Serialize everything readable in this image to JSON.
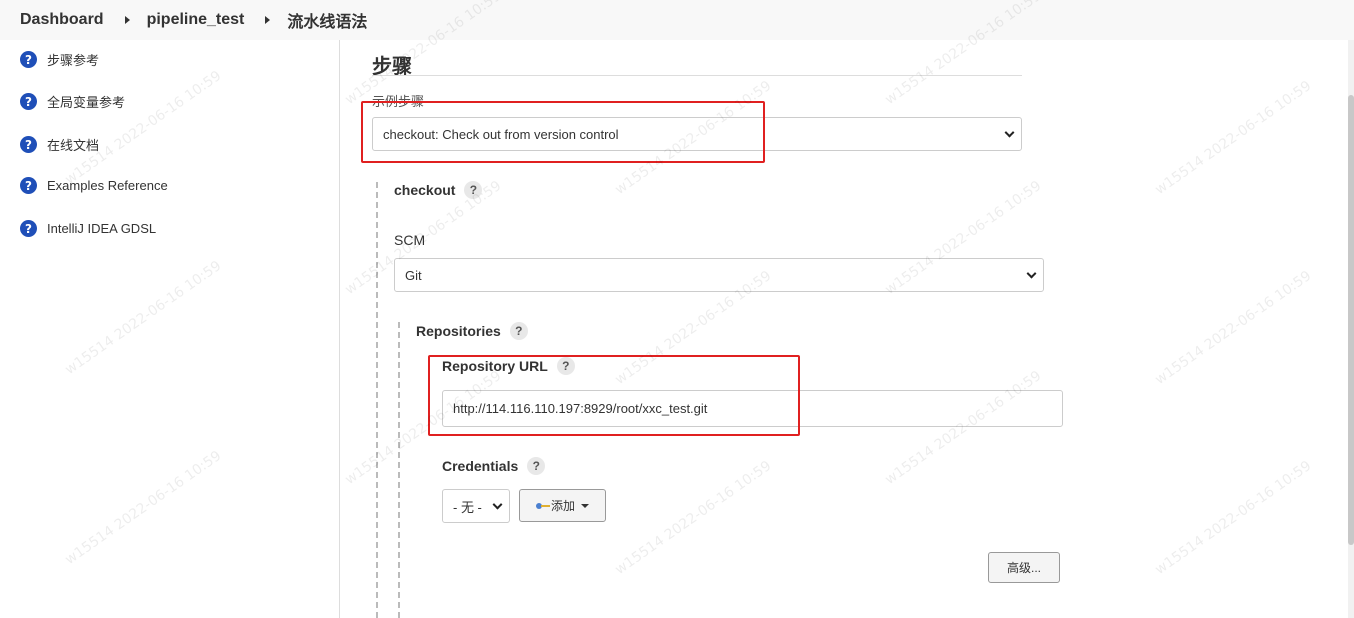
{
  "breadcrumb": {
    "items": [
      "Dashboard",
      "pipeline_test",
      "流水线语法"
    ]
  },
  "sidebar": {
    "items": [
      {
        "label": "步骤参考",
        "icon": "help-icon"
      },
      {
        "label": "全局变量参考",
        "icon": "help-icon"
      },
      {
        "label": "在线文档",
        "icon": "help-icon"
      },
      {
        "label": "Examples Reference",
        "icon": "help-icon"
      },
      {
        "label": "IntelliJ IDEA GDSL",
        "icon": "help-icon"
      }
    ]
  },
  "main": {
    "section_title": "步骤",
    "sample_step_label": "示例步骤",
    "sample_step_value": "checkout: Check out from version control",
    "checkout_label": "checkout",
    "scm_label": "SCM",
    "scm_value": "Git",
    "repositories_label": "Repositories",
    "repo_url_label": "Repository URL",
    "repo_url_value": "http://114.116.110.197:8929/root/xxc_test.git",
    "credentials_label": "Credentials",
    "credentials_value": "- 无 -",
    "add_button_label": "添加",
    "advanced_button_label": "高级..."
  },
  "help_badge": "?",
  "watermark_text": "w15514 2022-06-16 10:59",
  "colors": {
    "highlight": "#e02020",
    "help_icon": "#1f4fb8"
  }
}
